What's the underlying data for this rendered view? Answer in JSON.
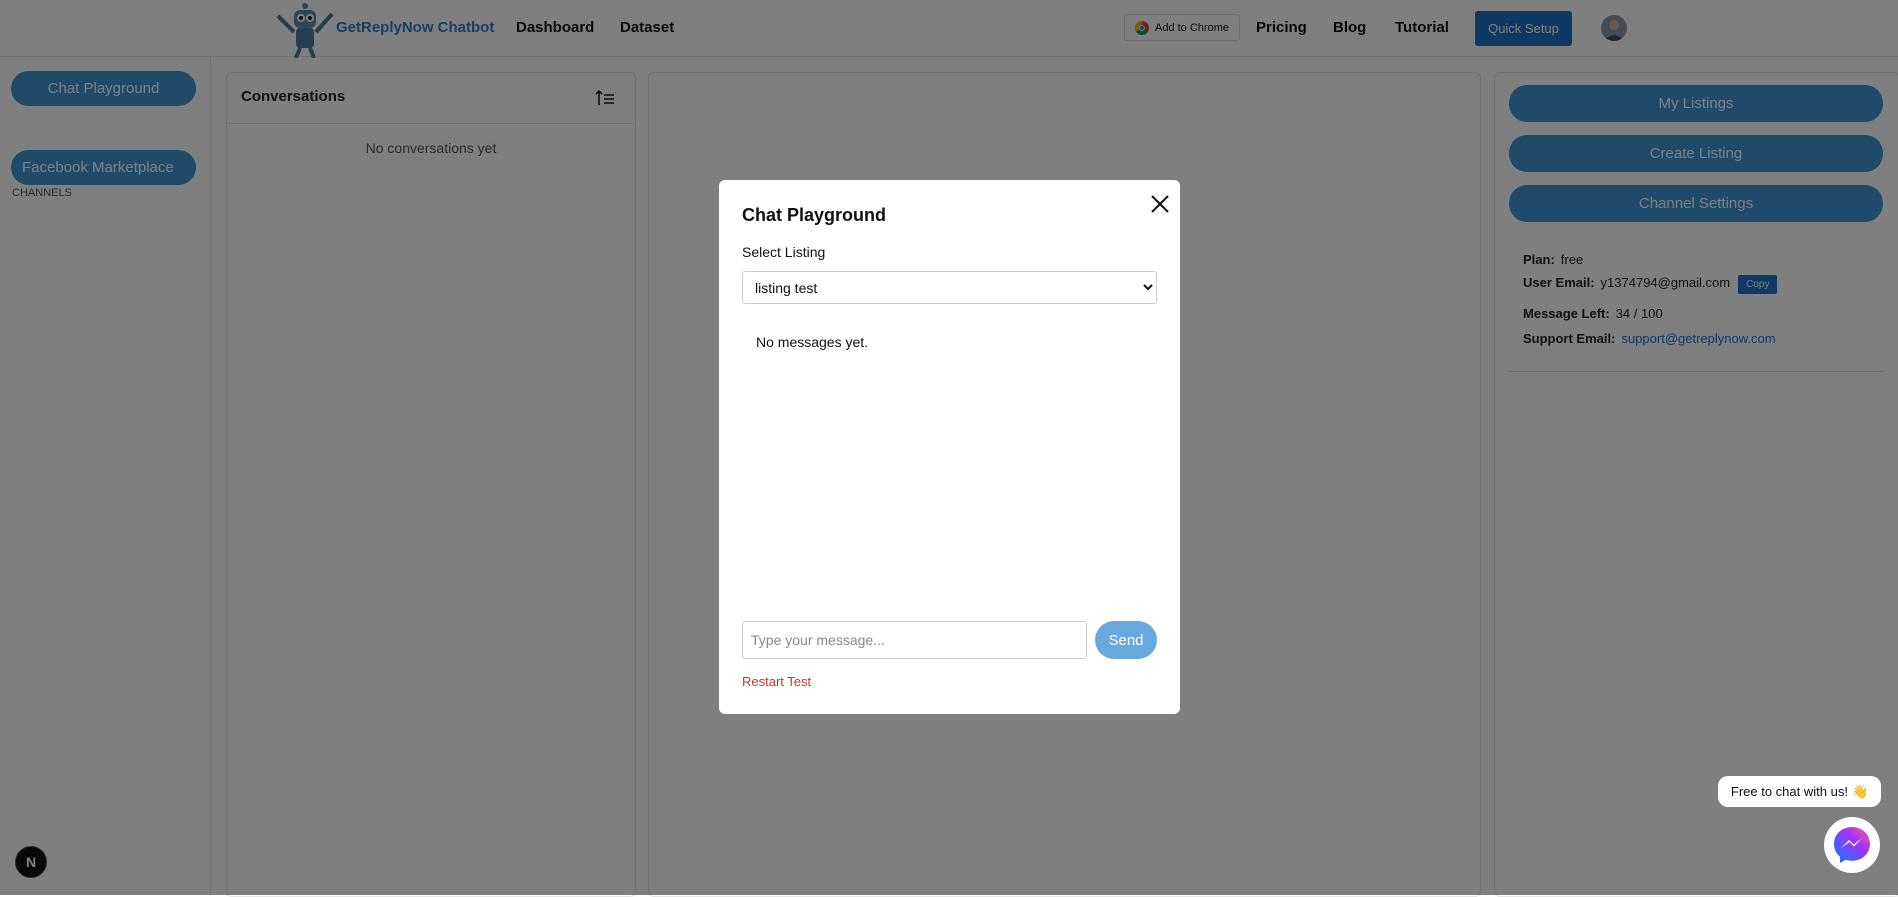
{
  "header": {
    "brand": "GetReplyNow Chatbot",
    "nav": [
      "Dashboard",
      "Dataset"
    ],
    "add_to_chrome": "Add to Chrome",
    "right_nav": [
      "Pricing",
      "Blog",
      "Tutorial"
    ],
    "quick_setup": "Quick Setup",
    "logo_icon": "robot-mascot-icon",
    "avatar_icon": "user-avatar-icon"
  },
  "sidebar": {
    "chat_playground": "Chat Playground",
    "channels_label": "CHANNELS",
    "channels": [
      "Facebook Marketplace"
    ]
  },
  "conversations": {
    "title": "Conversations",
    "empty_text": "No conversations yet",
    "sort_icon": "sort-icon"
  },
  "right_panel": {
    "buttons": [
      "My Listings",
      "Create Listing",
      "Channel Settings"
    ],
    "plan_label": "Plan:",
    "plan_value": "free",
    "email_label": "User Email:",
    "email_value": "y1374794@gmail.com",
    "copy_label": "Copy",
    "message_left_label": "Message Left:",
    "message_left_value": "34 / 100",
    "support_label": "Support Email:",
    "support_value": "support@getreplynow.com"
  },
  "modal": {
    "title": "Chat Playground",
    "select_label": "Select Listing",
    "selected_listing": "listing test",
    "empty_text": "No messages yet.",
    "input_placeholder": "Type your message...",
    "send_label": "Send",
    "restart_label": "Restart Test",
    "close_icon": "close-icon"
  },
  "widgets": {
    "chat_bubble": "Free to chat with us!",
    "chat_bubble_emoji": "👋",
    "messenger_icon": "messenger-icon",
    "next_badge": "N"
  },
  "colors": {
    "accent": "#3f95d4",
    "primary_button": "#1a73c9",
    "restart_red": "#c0392b"
  }
}
